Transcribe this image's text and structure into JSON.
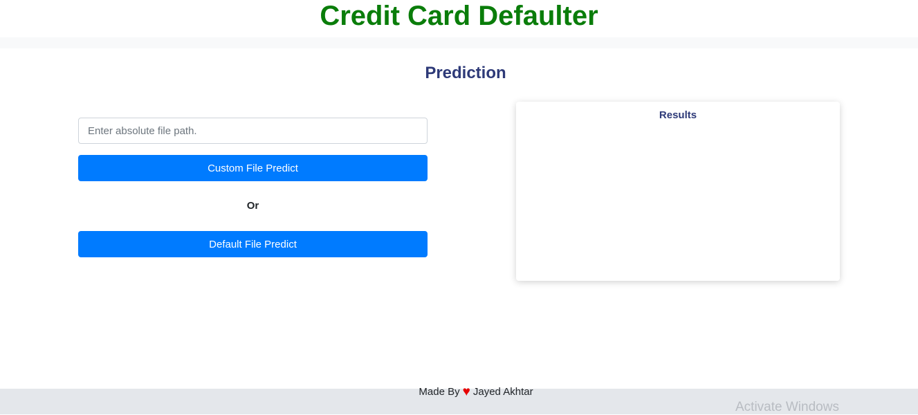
{
  "header": {
    "title": "Credit Card Defaulter"
  },
  "prediction": {
    "title": "Prediction",
    "file_input": {
      "value": "",
      "placeholder": "Enter absolute file path."
    },
    "custom_button_label": "Custom File Predict",
    "or_label": "Or",
    "default_button_label": "Default File Predict"
  },
  "results": {
    "title": "Results"
  },
  "footer": {
    "made_by_label": "Made By",
    "author_name": "Jayed Akhtar",
    "heart_icon": "heart-icon",
    "heart_glyph": "♥",
    "heart_color": "#e60000"
  },
  "overlay": {
    "watermark_text": "Activate Windows"
  },
  "colors": {
    "title_green": "#0a7d0a",
    "heading_navy": "#2e3a78",
    "button_blue": "#007bff",
    "footer_bg": "#e4e7eb"
  }
}
